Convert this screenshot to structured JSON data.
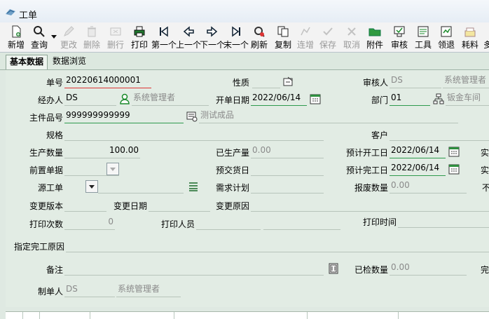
{
  "window": {
    "title": "工单"
  },
  "toolbar": [
    {
      "key": "new",
      "label": "新增",
      "enabled": true
    },
    {
      "key": "query",
      "label": "查询",
      "enabled": true
    },
    {
      "key": "edit",
      "label": "更改",
      "enabled": false
    },
    {
      "key": "delete",
      "label": "删除",
      "enabled": false
    },
    {
      "key": "delrow",
      "label": "删行",
      "enabled": false
    },
    {
      "key": "print",
      "label": "打印",
      "enabled": true
    },
    {
      "key": "first",
      "label": "第一个",
      "enabled": true
    },
    {
      "key": "prev",
      "label": "上一个",
      "enabled": true
    },
    {
      "key": "next",
      "label": "下一个",
      "enabled": true
    },
    {
      "key": "last",
      "label": "末一个",
      "enabled": true
    },
    {
      "key": "refresh",
      "label": "刷新",
      "enabled": true
    },
    {
      "key": "copy",
      "label": "复制",
      "enabled": true
    },
    {
      "key": "continue",
      "label": "连增",
      "enabled": false
    },
    {
      "key": "save",
      "label": "保存",
      "enabled": false
    },
    {
      "key": "cancel",
      "label": "取消",
      "enabled": false
    },
    {
      "key": "attach",
      "label": "附件",
      "enabled": true
    },
    {
      "key": "review",
      "label": "审核",
      "enabled": true
    },
    {
      "key": "tools",
      "label": "工具",
      "enabled": true
    },
    {
      "key": "pick",
      "label": "领退",
      "enabled": true
    },
    {
      "key": "material",
      "label": "耗料",
      "enabled": true
    },
    {
      "key": "more",
      "label": "多",
      "enabled": true
    }
  ],
  "tabs": {
    "basic": "基本数据",
    "browse": "数据浏览"
  },
  "form": {
    "order_no": {
      "label": "单号",
      "value": "20220614000001"
    },
    "nature": {
      "label": "性质"
    },
    "reviewer": {
      "label": "审核人",
      "value": "DS",
      "name": "系统管理者"
    },
    "handler": {
      "label": "经办人",
      "value": "DS",
      "name": "系统管理者"
    },
    "open_date": {
      "label": "开单日期",
      "value": "2022/06/14"
    },
    "dept": {
      "label": "部门",
      "value": "01",
      "name": "钣金车间"
    },
    "main_part": {
      "label": "主件品号",
      "value": "999999999999",
      "name": "测试成品"
    },
    "spec": {
      "label": "规格"
    },
    "customer": {
      "label": "客户"
    },
    "prod_qty": {
      "label": "生产数量",
      "value": "100.00"
    },
    "produced_qty": {
      "label": "已生产量",
      "value": "0.00"
    },
    "plan_start": {
      "label": "预计开工日",
      "value": "2022/06/14"
    },
    "prev_doc": {
      "label": "前置单据"
    },
    "delivery_date": {
      "label": "预交货日"
    },
    "plan_finish": {
      "label": "预计完工日",
      "value": "2022/06/14"
    },
    "source_order": {
      "label": "源工单"
    },
    "demand_plan": {
      "label": "需求计划"
    },
    "scrap_qty": {
      "label": "报废数量",
      "value": "0.00"
    },
    "change_version": {
      "label": "变更版本"
    },
    "change_date": {
      "label": "变更日期"
    },
    "change_reason": {
      "label": "变更原因"
    },
    "print_count": {
      "label": "打印次数",
      "value": "0"
    },
    "printer": {
      "label": "打印人员"
    },
    "print_time": {
      "label": "打印时间"
    },
    "assign_reason": {
      "label": "指定完工原因"
    },
    "remark": {
      "label": "备注"
    },
    "inspected_qty": {
      "label": "已检数量",
      "value": "0.00"
    },
    "creator": {
      "label": "制单人",
      "value": "DS",
      "name": "系统管理者"
    },
    "edge_labels": {
      "r1": "实",
      "r2": "实",
      "r3": "不",
      "r4": "完"
    }
  }
}
